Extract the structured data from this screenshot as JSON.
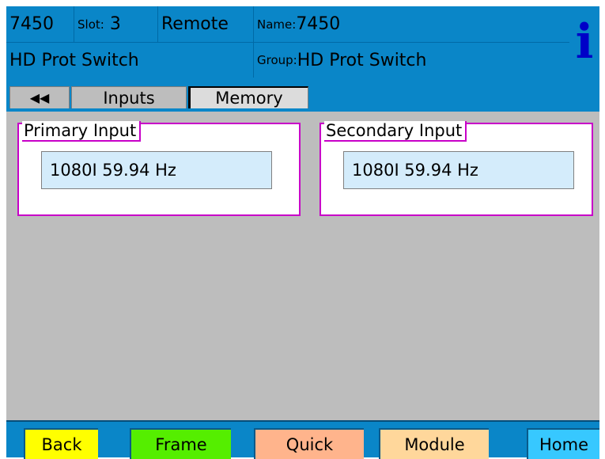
{
  "header": {
    "code": "7450",
    "slot_label": "Slot:",
    "slot_value": "3",
    "mode": "Remote",
    "name_label": "Name:",
    "name_value": "7450",
    "module_title": "HD Prot Switch",
    "group_label": "Group:",
    "group_value": "HD Prot Switch",
    "info_glyph": "i"
  },
  "tabs": {
    "back_arrows": "◀◀",
    "items": [
      {
        "label": "Inputs"
      },
      {
        "label": "Memory"
      }
    ]
  },
  "panels": {
    "primary": {
      "title": "Primary Input",
      "value": "1080I 59.94 Hz"
    },
    "secondary": {
      "title": "Secondary Input",
      "value": "1080I 59.94 Hz"
    }
  },
  "buttons": {
    "back": "Back",
    "frame": "Frame",
    "quick": "Quick",
    "module": "Module",
    "home": "Home"
  },
  "colors": {
    "header_blue": "#0a86c8",
    "panel_gray": "#bdbdbd",
    "group_border_magenta": "#c800c8",
    "field_bg": "#d4ecfb",
    "back_yellow": "#ffff00",
    "frame_green": "#55ee00",
    "quick_peach": "#ffb48c",
    "module_tan": "#ffd79b",
    "home_cyan": "#37c8ff"
  }
}
